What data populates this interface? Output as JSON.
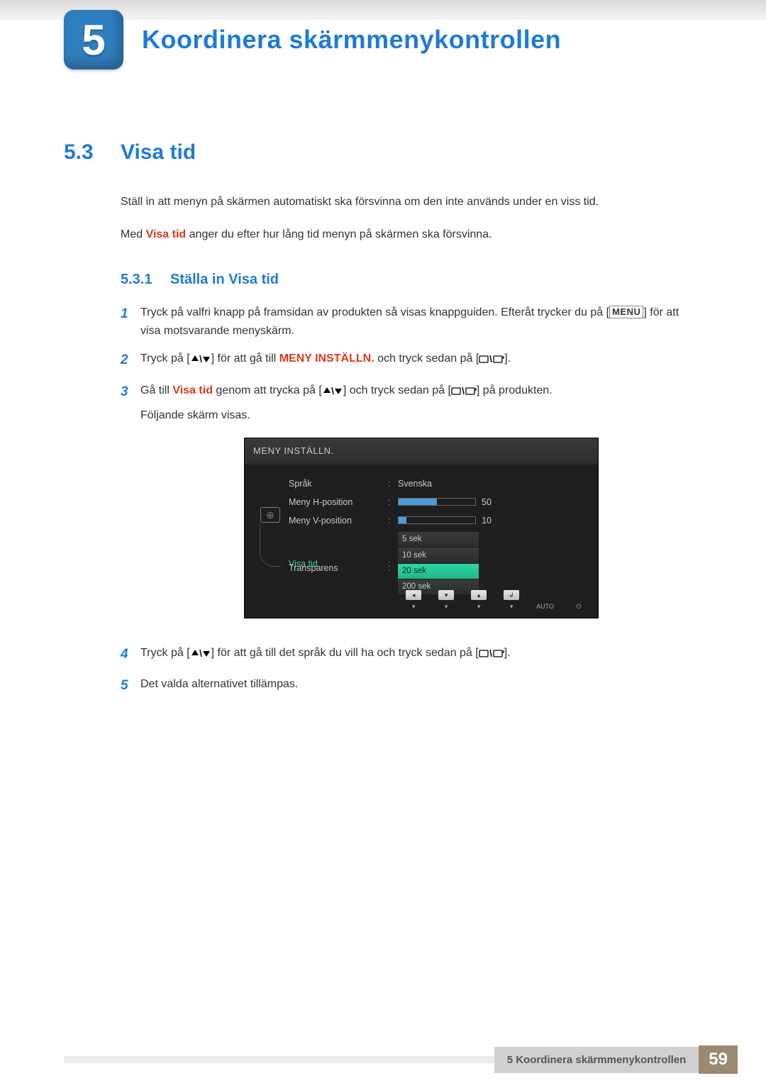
{
  "chapter": {
    "number": "5",
    "title": "Koordinera skärmmenykontrollen"
  },
  "section": {
    "number": "5.3",
    "title": "Visa tid"
  },
  "intro": {
    "p1": "Ställ in att menyn på skärmen automatiskt ska försvinna om den inte används under en viss tid.",
    "p2_a": "Med ",
    "p2_b": "Visa tid",
    "p2_c": " anger du efter hur lång tid menyn på skärmen ska försvinna."
  },
  "subsection": {
    "number": "5.3.1",
    "title": "Ställa in Visa tid"
  },
  "steps": {
    "s1_a": "Tryck på valfri knapp på framsidan av produkten så visas knappguiden. Efteråt trycker du på [",
    "s1_menu": "MENU",
    "s1_b": "] för att visa motsvarande menyskärm.",
    "s2_a": "Tryck på [",
    "s2_b": "] för att gå till ",
    "s2_c": "MENY INSTÄLLN.",
    "s2_d": " och tryck sedan på [",
    "s2_e": "].",
    "s3_a": "Gå till ",
    "s3_b": "Visa tid",
    "s3_c": " genom att trycka på [",
    "s3_d": "] och tryck sedan på [",
    "s3_e": "] på produkten.",
    "s3_f": "Följande skärm visas.",
    "s4_a": "Tryck på [",
    "s4_b": "] för att gå till det språk du vill ha och tryck sedan på [",
    "s4_c": "].",
    "s5": "Det valda alternativet tillämpas."
  },
  "osd": {
    "title": "MENY INSTÄLLN.",
    "rows": {
      "r1": {
        "label": "Språk",
        "value": "Svenska"
      },
      "r2": {
        "label": "Meny H-position",
        "value": "50",
        "fill": 50
      },
      "r3": {
        "label": "Meny V-position",
        "value": "10",
        "fill": 10
      },
      "r4": {
        "label": "Visa tid",
        "options": [
          "5 sek",
          "10 sek",
          "20 sek",
          "200 sek"
        ],
        "selected": "20 sek"
      },
      "r5": {
        "label": "Transparens"
      }
    },
    "footer": {
      "auto": "AUTO"
    }
  },
  "footer": {
    "text": "5 Koordinera skärmmenykontrollen",
    "page": "59"
  }
}
